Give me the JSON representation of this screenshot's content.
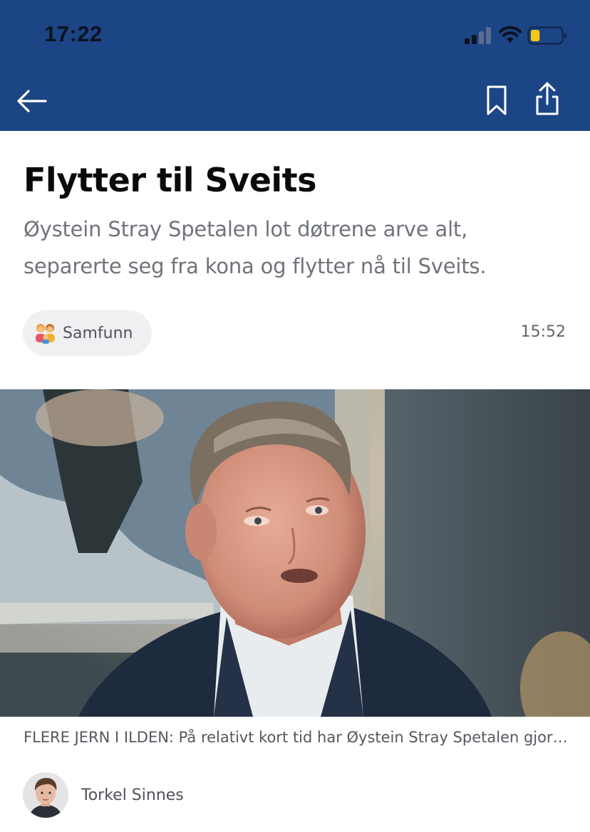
{
  "status_bar": {
    "time": "17:22",
    "signal_icon": "cellular-signal-icon",
    "wifi_icon": "wifi-icon",
    "battery_icon": "battery-low-icon",
    "battery_level": 0.3,
    "battery_color": "#f5c518"
  },
  "nav": {
    "background": "#1c4585",
    "back_icon": "arrow-left-icon",
    "bookmark_icon": "bookmark-icon",
    "share_icon": "share-icon"
  },
  "article": {
    "title": "Flytter til Sveits",
    "lead_line1": "Øystein Stray Spetalen lot døtrene arve alt,",
    "lead_line2": "separerte seg fra kona og flytter nå til Sveits.",
    "category": {
      "emoji_icon": "family-emoji-icon",
      "label": "Samfunn"
    },
    "published_time": "15:52",
    "image_caption": "FLERE JERN I ILDEN: På relativt kort tid har Øystein Stray Spetalen gjort flere store grep",
    "author": {
      "name": "Torkel Sinnes",
      "avatar_icon": "author-avatar"
    }
  }
}
